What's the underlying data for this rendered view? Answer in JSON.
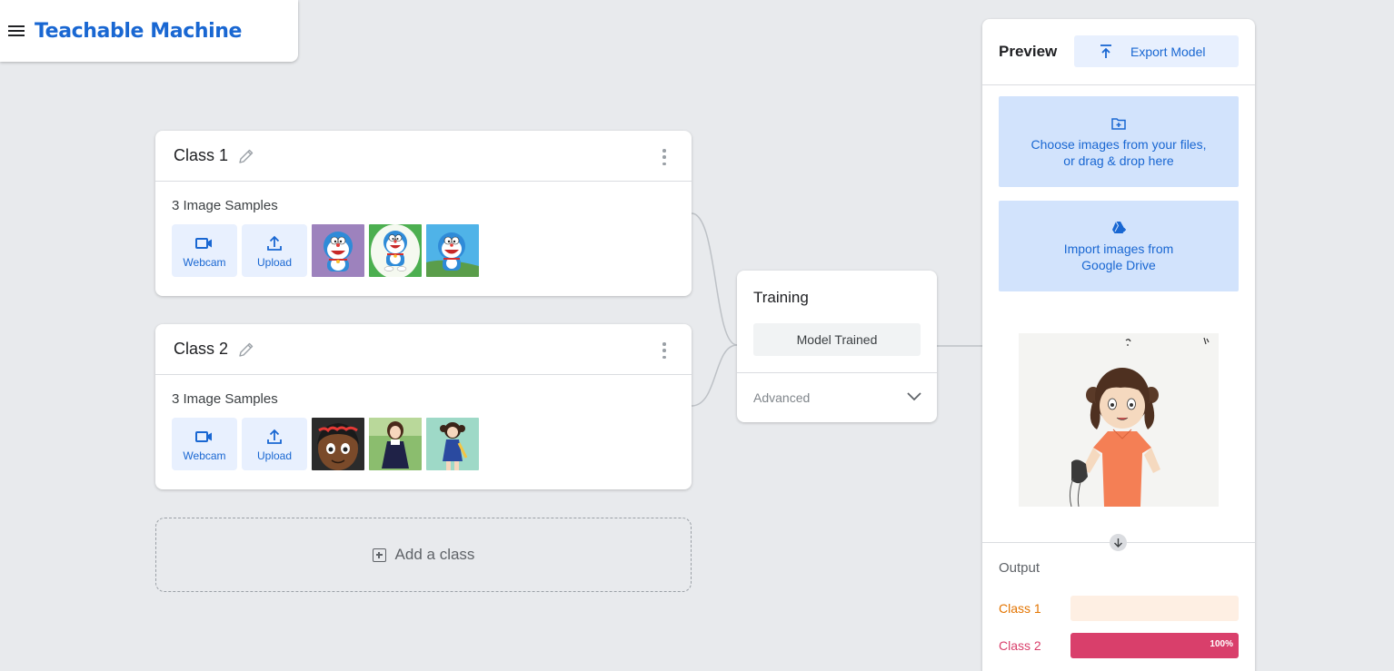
{
  "app": {
    "title": "Teachable Machine",
    "menu_icon": "menu-icon",
    "brand_color": "#1967d2"
  },
  "classes": [
    {
      "title": "Class 1",
      "samples_label": "3 Image Samples",
      "webcam_label": "Webcam",
      "upload_label": "Upload",
      "thumbnails": [
        "doraemon-image-1",
        "doraemon-image-2",
        "doraemon-image-3"
      ]
    },
    {
      "title": "Class 2",
      "samples_label": "3 Image Samples",
      "webcam_label": "Webcam",
      "upload_label": "Upload",
      "thumbnails": [
        "shizuka-image-1",
        "shizuka-image-2",
        "shizuka-image-3"
      ]
    }
  ],
  "add_class": {
    "label": "Add a class"
  },
  "training": {
    "title": "Training",
    "button_label": "Model Trained",
    "advanced_label": "Advanced"
  },
  "preview": {
    "title": "Preview",
    "export_label": "Export Model",
    "file_drop_line1": "Choose images from your files,",
    "file_drop_line2": "or drag & drop here",
    "drive_line1": "Import images from",
    "drive_line2": "Google Drive",
    "output_label": "Output",
    "outputs": [
      {
        "name": "Class 1",
        "color": "#e37400",
        "track_color": "#feefe3",
        "value": 0,
        "percent_label": ""
      },
      {
        "name": "Class 2",
        "color": "#d93f6b",
        "track_color": "#fbe9ee",
        "value": 1.0,
        "percent_label": "100%"
      }
    ]
  }
}
